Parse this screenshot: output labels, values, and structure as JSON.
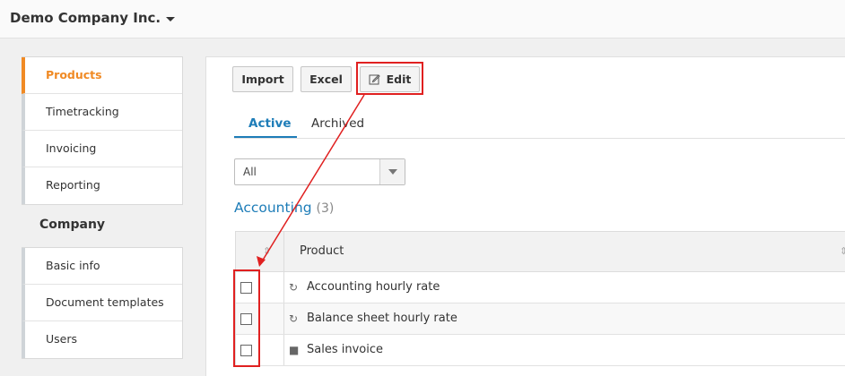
{
  "header": {
    "company_name": "Demo Company Inc."
  },
  "sidebar": {
    "groups": [
      {
        "items": [
          {
            "label": "Products",
            "active": true
          },
          {
            "label": "Timetracking"
          },
          {
            "label": "Invoicing"
          },
          {
            "label": "Reporting"
          }
        ]
      },
      {
        "heading": "Company",
        "items": [
          {
            "label": "Basic info"
          },
          {
            "label": "Document templates"
          },
          {
            "label": "Users"
          }
        ]
      }
    ]
  },
  "toolbar": {
    "import_label": "Import",
    "excel_label": "Excel",
    "edit_label": "Edit"
  },
  "tabs": [
    {
      "label": "Active",
      "active": true
    },
    {
      "label": "Archived"
    }
  ],
  "filter": {
    "value": "All"
  },
  "section": {
    "title": "Accounting",
    "count": "(3)"
  },
  "table": {
    "columns": [
      "Product"
    ],
    "rows": [
      {
        "label": "Accounting hourly rate",
        "icon": "recurring-icon"
      },
      {
        "label": "Balance sheet hourly rate",
        "icon": "recurring-icon"
      },
      {
        "label": "Sales invoice",
        "icon": "box-icon"
      }
    ]
  },
  "colors": {
    "accent": "#f08a24",
    "link": "#1e7db8",
    "highlight": "#e02020"
  }
}
